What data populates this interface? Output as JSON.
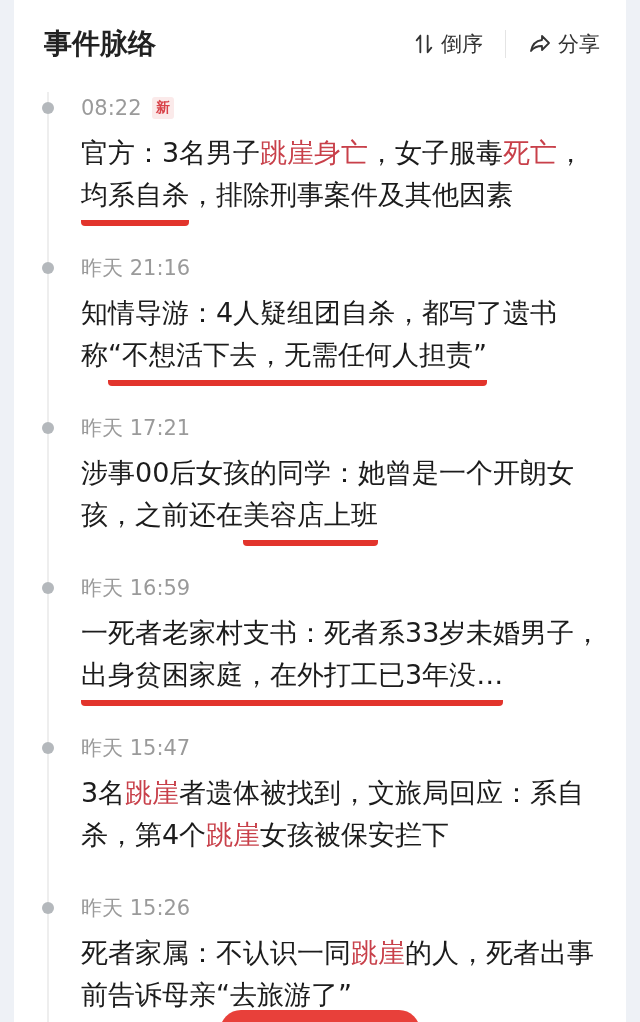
{
  "header": {
    "title": "事件脉络",
    "sort_label": "倒序",
    "share_label": "分享"
  },
  "events": [
    {
      "time": "08:22",
      "new_badge": "新",
      "segments": [
        {
          "text": "官方：3名男子",
          "highlight": false,
          "marked": false
        },
        {
          "text": "跳崖身亡",
          "highlight": true,
          "marked": false
        },
        {
          "text": "，女子服毒",
          "highlight": false,
          "marked": false
        },
        {
          "text": "死亡",
          "highlight": true,
          "marked": false
        },
        {
          "text": "，",
          "highlight": false,
          "marked": false
        },
        {
          "text": "均系自杀",
          "highlight": false,
          "marked": true
        },
        {
          "text": "，排除刑事案件及其他因素",
          "highlight": false,
          "marked": false
        }
      ]
    },
    {
      "time": "昨天 21:16",
      "segments": [
        {
          "text": "知情导游：4人疑组团自杀，都写了遗书称",
          "highlight": false,
          "marked": false
        },
        {
          "text": "“不想活下去，无需任何人担责”",
          "highlight": false,
          "marked": true
        }
      ]
    },
    {
      "time": "昨天 17:21",
      "segments": [
        {
          "text": "涉事00后女孩的同学：她曾是一个开朗女孩，之前还在",
          "highlight": false,
          "marked": false
        },
        {
          "text": "美容店上班",
          "highlight": false,
          "marked": true
        }
      ]
    },
    {
      "time": "昨天 16:59",
      "segments": [
        {
          "text": "一死者老家村支书：死者系33岁未婚男子，",
          "highlight": false,
          "marked": false
        },
        {
          "text": "出身贫困家庭，在外打工已3年没…",
          "highlight": false,
          "marked": true
        }
      ]
    },
    {
      "time": "昨天 15:47",
      "segments": [
        {
          "text": "3名",
          "highlight": false,
          "marked": false
        },
        {
          "text": "跳崖",
          "highlight": true,
          "marked": false
        },
        {
          "text": "者遗体被找到，文旅局回应：系自杀，第4个",
          "highlight": false,
          "marked": false
        },
        {
          "text": "跳崖",
          "highlight": true,
          "marked": false
        },
        {
          "text": "女孩被保安拦下",
          "highlight": false,
          "marked": false
        }
      ]
    },
    {
      "time": "昨天 15:26",
      "segments": [
        {
          "text": "死者家属：不认识一同",
          "highlight": false,
          "marked": false
        },
        {
          "text": "跳崖",
          "highlight": true,
          "marked": false
        },
        {
          "text": "的人，死者出事前告诉母亲“去旅游了”",
          "highlight": false,
          "marked": false
        }
      ]
    }
  ]
}
